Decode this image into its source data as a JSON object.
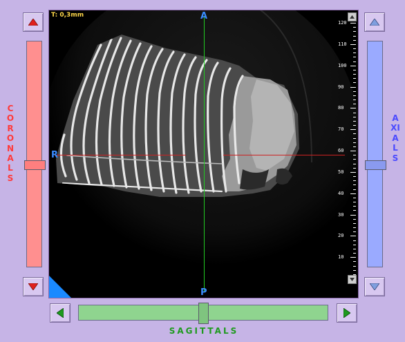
{
  "viewer": {
    "thickness_label": "T: 0,3mm",
    "orientation": {
      "top": "A",
      "bottom": "P",
      "left": "R"
    },
    "ruler": {
      "labels": [
        "120",
        "110",
        "100",
        "90",
        "80",
        "70",
        "60",
        "50",
        "40",
        "30",
        "20",
        "10"
      ]
    }
  },
  "coronals": {
    "label": "CORONALS",
    "color": "#ff8f8f",
    "position": 0.55,
    "up_icon": "triangle-up-red-icon",
    "down_icon": "triangle-down-red-icon"
  },
  "axials": {
    "label": "AXIALS",
    "color": "#9aaaff",
    "position": 0.55,
    "up_icon": "triangle-up-blue-icon",
    "down_icon": "triangle-down-blue-icon"
  },
  "sagittals": {
    "label": "SAGITTALS",
    "color": "#8fd48f",
    "position": 0.5,
    "left_icon": "triangle-left-green-icon",
    "right_icon": "triangle-right-green-icon"
  },
  "crosshair": {
    "vertical_color": "#22cc22",
    "horizontal_color": "#cc2222"
  }
}
